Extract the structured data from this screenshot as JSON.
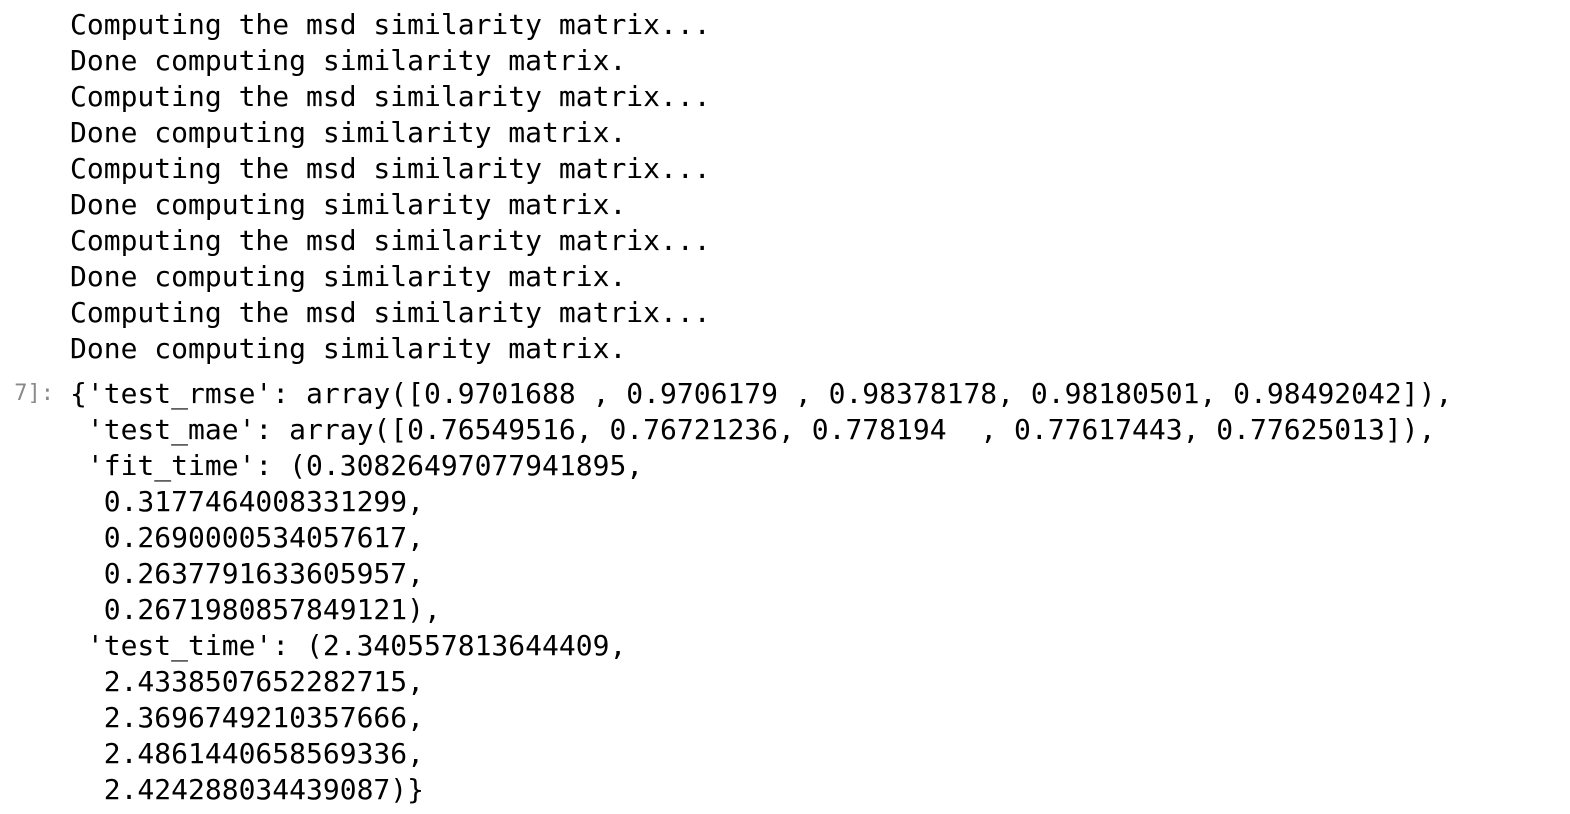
{
  "stdout": {
    "lines": [
      "Computing the msd similarity matrix...",
      "Done computing similarity matrix.",
      "Computing the msd similarity matrix...",
      "Done computing similarity matrix.",
      "Computing the msd similarity matrix...",
      "Done computing similarity matrix.",
      "Computing the msd similarity matrix...",
      "Done computing similarity matrix.",
      "Computing the msd similarity matrix...",
      "Done computing similarity matrix."
    ]
  },
  "output": {
    "prompt": "7]:",
    "lines": [
      "{'test_rmse': array([0.9701688 , 0.9706179 , 0.98378178, 0.98180501, 0.98492042]),",
      " 'test_mae': array([0.76549516, 0.76721236, 0.778194  , 0.77617443, 0.77625013]),",
      " 'fit_time': (0.30826497077941895,",
      "  0.3177464008331299,",
      "  0.2690000534057617,",
      "  0.2637791633605957,",
      "  0.2671980857849121),",
      " 'test_time': (2.340557813644409,",
      "  2.4338507652282715,",
      "  2.3696749210357666,",
      "  2.4861440658569336,",
      "  2.424288034439087)}"
    ]
  }
}
